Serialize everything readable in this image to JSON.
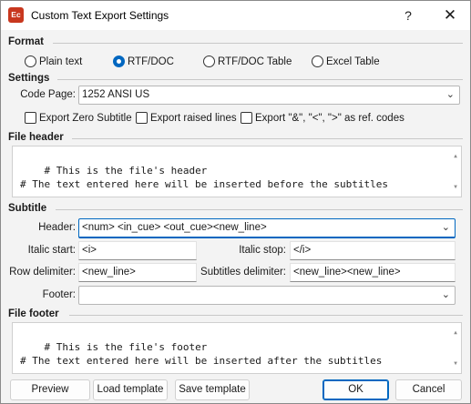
{
  "window": {
    "app_icon_text": "Ec",
    "title": "Custom Text Export Settings",
    "help_glyph": "?",
    "close_glyph": "✕"
  },
  "format": {
    "label": "Format",
    "options": [
      {
        "label": "Plain text",
        "checked": false
      },
      {
        "label": "RTF/DOC",
        "checked": true
      },
      {
        "label": "RTF/DOC Table",
        "checked": false
      },
      {
        "label": "Excel Table",
        "checked": false
      }
    ]
  },
  "settings": {
    "label": "Settings",
    "code_page_label": "Code Page:",
    "code_page_value": "1252 ANSI US",
    "checkboxes": [
      {
        "label": "Export Zero Subtitle",
        "checked": false
      },
      {
        "label": "Export raised lines",
        "checked": false
      },
      {
        "label": "Export \"&\", \"<\", \">\" as ref. codes",
        "checked": false
      }
    ]
  },
  "file_header": {
    "label": "File header",
    "text": "# This is the file's header\n# The text entered here will be inserted before the subtitles"
  },
  "subtitle": {
    "label": "Subtitle",
    "header_label": "Header:",
    "header_value": "<num> <in_cue> <out_cue><new_line>",
    "italic_start_label": "Italic start:",
    "italic_start_value": "<i>",
    "italic_stop_label": "Italic stop:",
    "italic_stop_value": "</i>",
    "row_delimiter_label": "Row delimiter:",
    "row_delimiter_value": "<new_line>",
    "subtitles_delimiter_label": "Subtitles delimiter:",
    "subtitles_delimiter_value": "<new_line><new_line>",
    "footer_label": "Footer:",
    "footer_value": ""
  },
  "file_footer": {
    "label": "File footer",
    "text": "# This is the file's footer\n# The text entered here will be inserted after the subtitles"
  },
  "buttons": {
    "preview": "Preview",
    "load_template": "Load template",
    "save_template": "Save template",
    "ok": "OK",
    "cancel": "Cancel"
  },
  "icons": {
    "dropdown_arrow": "chevron-down-icon",
    "scroll_up": "scroll-up-arrow-icon",
    "scroll_down": "scroll-down-arrow-icon"
  },
  "colors": {
    "accent": "#0067c0",
    "app_icon": "#c8371e"
  }
}
